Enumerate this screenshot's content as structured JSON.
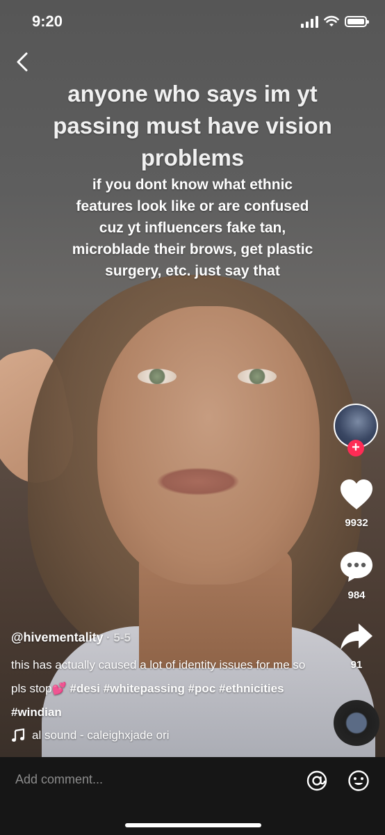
{
  "status_bar": {
    "time": "9:20",
    "icons": [
      "signal-icon",
      "wifi-icon",
      "battery-icon"
    ]
  },
  "overlay": {
    "title": "anyone who says im yt passing must have vision problems",
    "body": "if you dont know what ethnic features look like or are confused cuz yt influencers fake tan, microblade their brows, get plastic surgery, etc. just say that"
  },
  "rail": {
    "likes": "9932",
    "comments": "984",
    "shares": "91"
  },
  "post": {
    "username": "@hivementality",
    "date": "· 5-5",
    "caption_text": "this has actually caused a lot of identity issues for me so pls stop💕",
    "hashtags": [
      "#desi",
      "#whitepassing",
      "#poc",
      "#ethnicities",
      "#windian"
    ],
    "sound": "al sound - caleighxjade   ori"
  },
  "comment_bar": {
    "placeholder": "Add comment..."
  },
  "colors": {
    "follow_red": "#fe2c55",
    "comment_bar_bg": "#161616"
  }
}
